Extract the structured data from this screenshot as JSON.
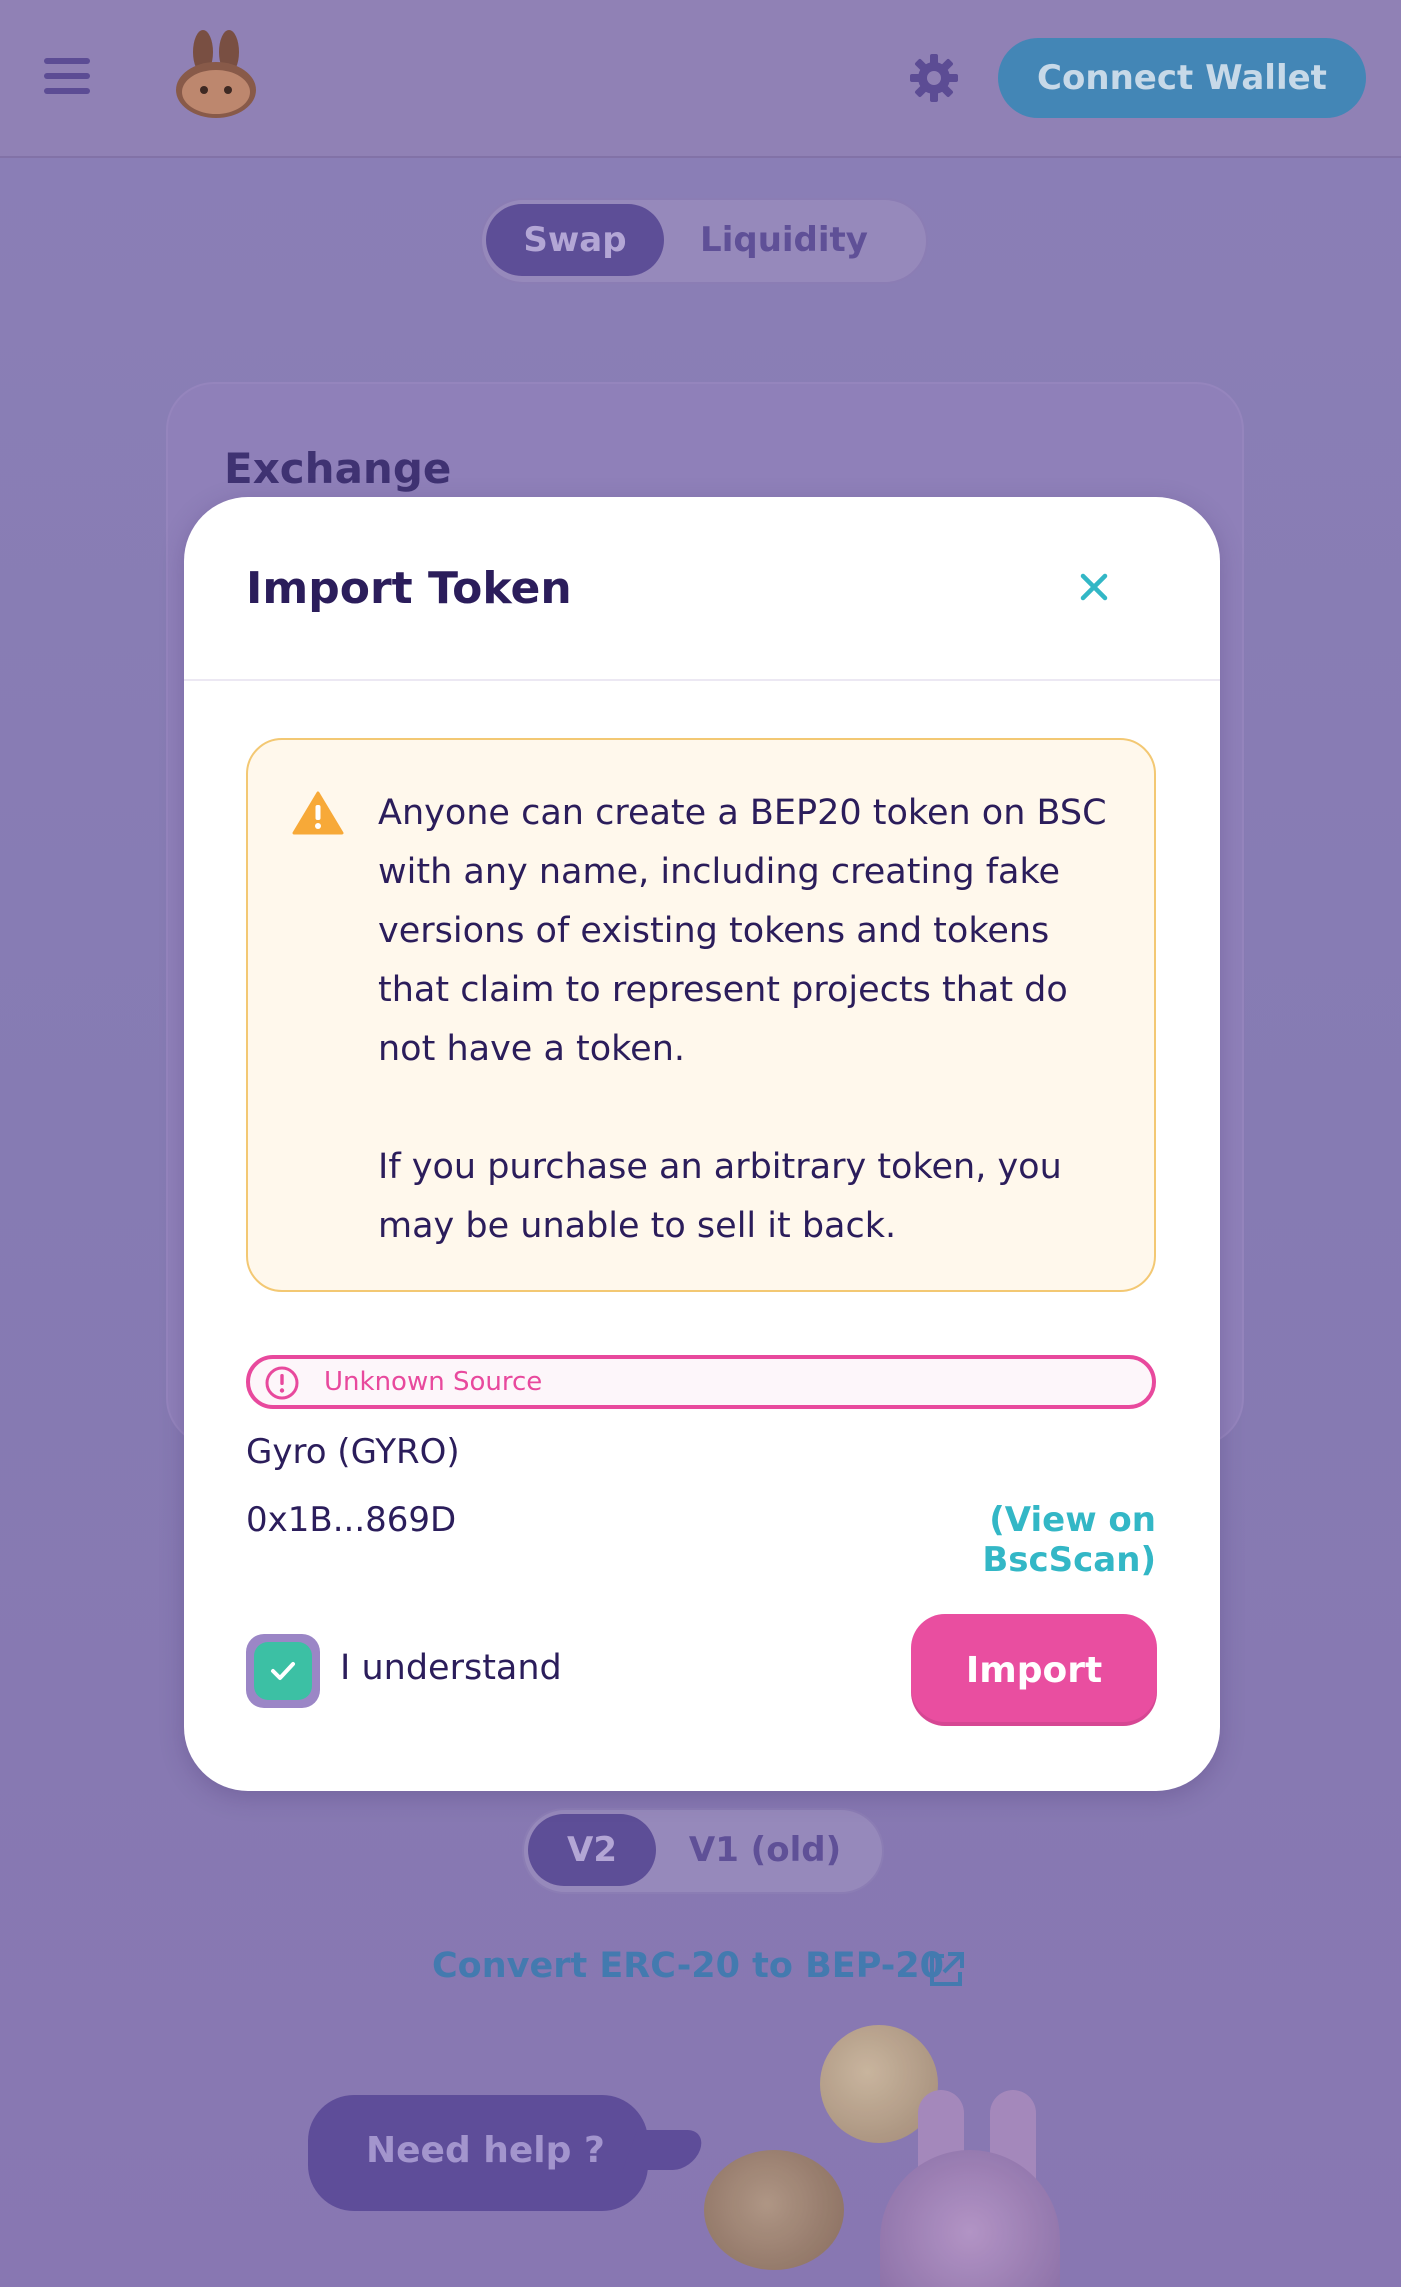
{
  "header": {
    "menu_icon": "hamburger-icon",
    "logo_icon": "bunny-logo-icon",
    "settings_icon": "gear-icon",
    "connect_wallet_label": "Connect Wallet"
  },
  "nav_tabs": [
    {
      "label": "Swap",
      "active": true
    },
    {
      "label": "Liquidity",
      "active": false
    }
  ],
  "exchange_card": {
    "title": "Exchange"
  },
  "version_toggle": [
    {
      "label": "V2",
      "active": true
    },
    {
      "label": "V1 (old)",
      "active": false
    }
  ],
  "convert_link": {
    "label": "Convert ERC-20 to BEP-20",
    "icon": "external-link-icon"
  },
  "help": {
    "label": "Need help ?"
  },
  "modal": {
    "title": "Import Token",
    "close_icon": "close-icon",
    "warning": {
      "icon": "warning-triangle-icon",
      "paragraph1": "Anyone can create a BEP20 token on BSC with any name, including creating fake versions of existing tokens and tokens that claim to represent projects that do not have a token.",
      "paragraph2": "If you purchase an arbitrary token, you may be unable to sell it back."
    },
    "source_tag": {
      "icon": "alert-circle-icon",
      "label": "Unknown Source"
    },
    "token": {
      "name_symbol": "Gyro  (GYRO)",
      "address": "0x1B...869D",
      "explorer_link": "(View on BscScan)"
    },
    "acknowledge": {
      "checked": true,
      "label": "I understand"
    },
    "import_label": "Import"
  },
  "colors": {
    "primary_pink": "#e94ea0",
    "accent_teal": "#33b7c6",
    "warning_bg": "#fff8ec",
    "warning_border": "#f3c873",
    "text_dark": "#2b1d5b",
    "overlay_purple": "#8a7cb4"
  }
}
